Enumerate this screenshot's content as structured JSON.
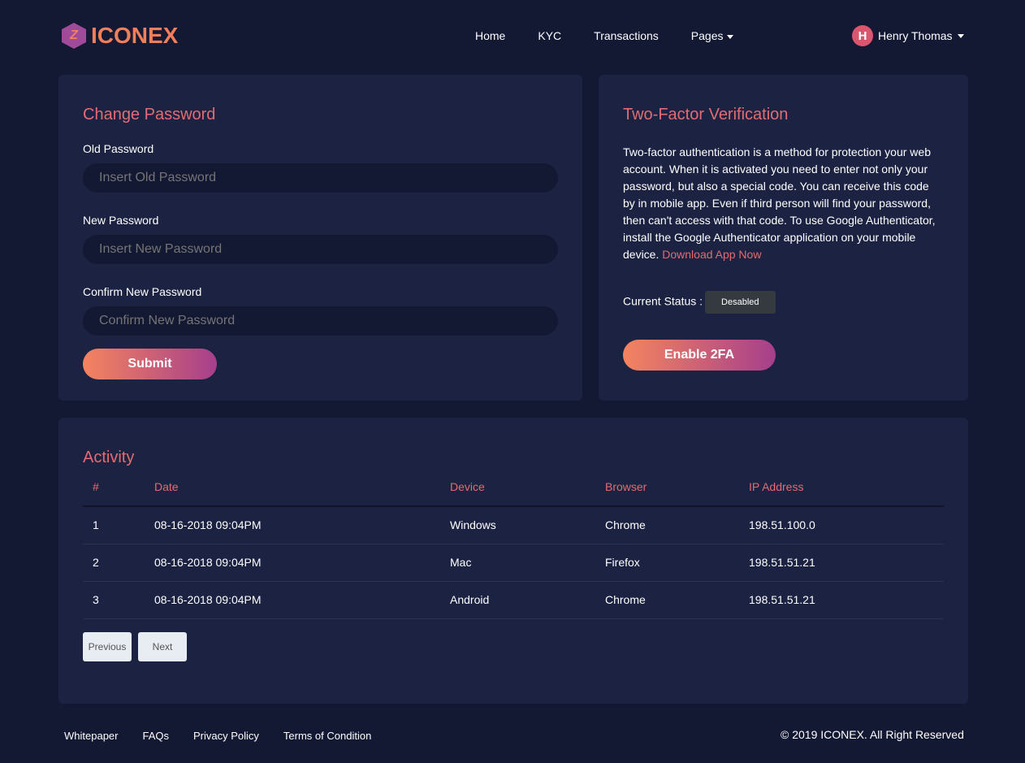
{
  "brand": {
    "name": "ICONEX",
    "mark": "Z"
  },
  "nav": {
    "items": [
      "Home",
      "KYC",
      "Transactions",
      "Pages"
    ]
  },
  "user": {
    "initial": "H",
    "name": "Henry Thomas"
  },
  "password": {
    "title": "Change Password",
    "fields": [
      {
        "label": "Old Password",
        "placeholder": "Insert Old Password"
      },
      {
        "label": "New Password",
        "placeholder": "Insert New Password"
      },
      {
        "label": "Confirm New Password",
        "placeholder": "Confirm New Password"
      }
    ],
    "submit": "Submit"
  },
  "twofa": {
    "title": "Two-Factor Verification",
    "description": "Two-factor authentication is a method for protection your web account. When it is activated you need to enter not only your password, but also a special code. You can receive this code by in mobile app. Even if third person will find your password, then can't access with that code. To use Google Authenticator, install the Google Authenticator application on your mobile device.",
    "link": "Download App Now",
    "status_label": "Current Status :",
    "status": "Desabled",
    "button": "Enable 2FA"
  },
  "activity": {
    "title": "Activity",
    "headers": [
      "#",
      "Date",
      "Device",
      "Browser",
      "IP Address"
    ],
    "rows": [
      [
        "1",
        "08-16-2018 09:04PM",
        "Windows",
        "Chrome",
        "198.51.100.0"
      ],
      [
        "2",
        "08-16-2018 09:04PM",
        "Mac",
        "Firefox",
        "198.51.51.21"
      ],
      [
        "3",
        "08-16-2018 09:04PM",
        "Android",
        "Chrome",
        "198.51.51.21"
      ]
    ],
    "prev": "Previous",
    "next": "Next"
  },
  "footer": {
    "links": [
      "Whitepaper",
      "FAQs",
      "Privacy Policy",
      "Terms of Condition"
    ],
    "copyright": "© 2019 ICONEX. All Right Reserved"
  }
}
